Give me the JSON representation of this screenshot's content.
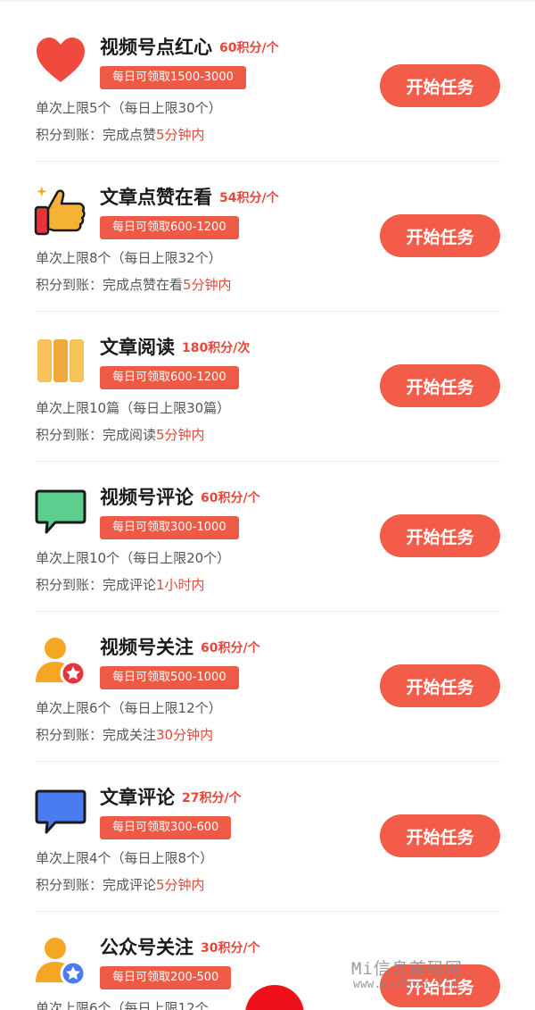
{
  "colors": {
    "accent": "#ef5a47",
    "points_text": "#e5483a",
    "title_text": "#1a1a1a",
    "body_text": "#555555",
    "float_button": "#f0101a"
  },
  "tasks": [
    {
      "icon": "heart-icon",
      "title": "视频号点红心",
      "points": "60积分/个",
      "daily": "每日可领取1500-3000",
      "limit": "单次上限5个（每日上限30个）",
      "arrive_prefix": "积分到账：完成点赞",
      "arrive_time": "5分钟内",
      "button": "开始任务"
    },
    {
      "icon": "thumbs-up-icon",
      "title": "文章点赞在看",
      "points": "54积分/个",
      "daily": "每日可领取600-1200",
      "limit": "单次上限8个（每日上限32个）",
      "arrive_prefix": "积分到账：完成点赞在看",
      "arrive_time": "5分钟内",
      "button": "开始任务"
    },
    {
      "icon": "book-icon",
      "title": "文章阅读",
      "points": "180积分/次",
      "daily": "每日可领取600-1200",
      "limit": "单次上限10篇（每日上限30篇）",
      "arrive_prefix": "积分到账：完成阅读",
      "arrive_time": "5分钟内",
      "button": "开始任务"
    },
    {
      "icon": "green-comment-icon",
      "title": "视频号评论",
      "points": "60积分/个",
      "daily": "每日可领取300-1000",
      "limit": "单次上限10个（每日上限20个）",
      "arrive_prefix": "积分到账：完成评论",
      "arrive_time": "1小时内",
      "button": "开始任务"
    },
    {
      "icon": "user-star-icon",
      "title": "视频号关注",
      "points": "60积分/个",
      "daily": "每日可领取500-1000",
      "limit": "单次上限6个（每日上限12个）",
      "arrive_prefix": "积分到账：完成关注",
      "arrive_time": "30分钟内",
      "button": "开始任务"
    },
    {
      "icon": "blue-comment-icon",
      "title": "文章评论",
      "points": "27积分/个",
      "daily": "每日可领取300-600",
      "limit": "单次上限4个（每日上限8个）",
      "arrive_prefix": "积分到账：完成评论",
      "arrive_time": "5分钟内",
      "button": "开始任务"
    },
    {
      "icon": "user-blue-star-icon",
      "title": "公众号关注",
      "points": "30积分/个",
      "daily": "每日可领取200-500",
      "limit": "单次上限6个（每日上限12个",
      "arrive_prefix": "",
      "arrive_time": "",
      "button": "开始任务"
    }
  ],
  "watermark": {
    "main": "Mi信息首码网",
    "url": "www.mixinxi.com"
  }
}
